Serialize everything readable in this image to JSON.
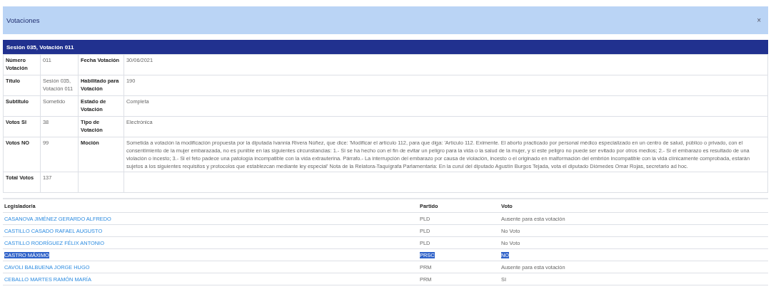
{
  "dialog": {
    "title": "Votaciones",
    "close": "×"
  },
  "session_title": "Sesión 035, Votación 011",
  "details": [
    {
      "label_1": "Número Votación",
      "value_1": "011",
      "label_2": "Fecha Votación",
      "value_2": "30/06/2021"
    },
    {
      "label_1": "Título",
      "value_1": "Sesión 035, Votación 011",
      "label_2": "Habilitado para Votación",
      "value_2": "190"
    },
    {
      "label_1": "Subtitulo",
      "value_1": "Sometido",
      "label_2": "Estado de Votación",
      "value_2": "Completa"
    },
    {
      "label_1": "Votos SI",
      "value_1": "38",
      "label_2": "Tipo de Votación",
      "value_2": "Electrónica"
    },
    {
      "label_1": "Votos NO",
      "value_1": "99",
      "label_2": "Moción",
      "value_2": "Sometida a votación la modificación propuesta por la diputada Ivannia Rivera Núñez, que dice: 'Modificar el artículo 112, para que diga: 'Artículo 112. Eximente. El aborto practicado por personal médico especializado en un centro de salud, público o privado, con el consentimiento de la mujer embarazada, no es punible en las siguientes circunstancias: 1.- Si se ha hecho con el fin de evitar un peligro para la vida o la salud de la mujer, y si este peligro no puede ser evitado por otros medios; 2.- Si el embarazo es resultado de una violación o incesto; 3.- Si el feto padece una patología incompatible con la vida extrauterina. Párrafo.- La interrupción del embarazo por causa de violación, incesto o el originado en malformación del embrión incompatible con la vida clínicamente comprobada, estarán sujetos a los siguientes requisitos y protocolos que establezcan mediante ley especial' Nota de la Relatora-Taquígrafa Parlamentaria: En la curul del diputado Agustín Burgos Tejada, vota el diputado Diómedes Omar Rojas, secretario ad hoc."
    },
    {
      "label_1": "Total Votos",
      "value_1": "137"
    }
  ],
  "votes": {
    "columns": [
      "Legislador/a",
      "Partido",
      "Voto"
    ],
    "rows": [
      {
        "legislator": "CASANOVA JIMÉNEZ GERARDO ALFREDO",
        "party": "PLD",
        "vote": "Ausente para esta votación",
        "selected": false
      },
      {
        "legislator": "CASTILLO CASADO RAFAEL AUGUSTO",
        "party": "PLD",
        "vote": "No Voto",
        "selected": false
      },
      {
        "legislator": "CASTILLO RODRÍGUEZ FÉLIX ANTONIO",
        "party": "PLD",
        "vote": "No Voto",
        "selected": false
      },
      {
        "legislator": "CASTRO MÁXIMO",
        "party": "PRSC",
        "vote": "NO",
        "selected": true
      },
      {
        "legislator": "CAVOLI BALBUENA JORGE HUGO",
        "party": "PRM",
        "vote": "Ausente para esta votación",
        "selected": false
      },
      {
        "legislator": "CEBALLO MARTES RAMÓN MARÍA",
        "party": "PRM",
        "vote": "SI",
        "selected": false
      }
    ]
  }
}
